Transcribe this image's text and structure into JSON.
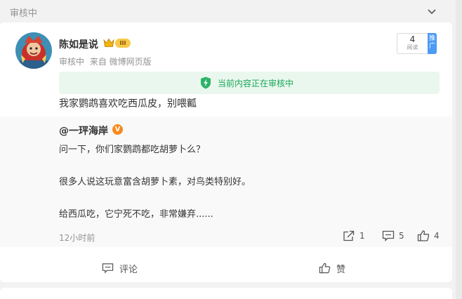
{
  "section": {
    "title": "审核中"
  },
  "post": {
    "username": "陈如是说",
    "vip_badge": "III",
    "meta": {
      "status": "审核中",
      "source": "来自 微博网页版"
    },
    "reads": {
      "count": "4",
      "label": "阅读"
    },
    "promote_label": "推广",
    "notice": "当前内容正在审核中",
    "text": "我家鹦鹉喜欢吃西瓜皮，别喂瓤"
  },
  "quote": {
    "username": "@一玶海岸",
    "verified_badge": "V",
    "lines": [
      "问一下，你们家鹦鹉都吃胡萝卜么？",
      "很多人说这玩意富含胡萝卜素，对鸟类特别好。",
      "给西瓜吃，它宁死不吃，非常嫌弃......"
    ],
    "time": "12小时前",
    "stats": {
      "reposts": "1",
      "comments": "5",
      "likes": "4"
    }
  },
  "actions": {
    "comment": "评论",
    "like": "赞"
  },
  "colors": {
    "accent_green": "#1aa75a",
    "notice_bg": "#eaf7ee",
    "promote_blue": "#4c9bf5",
    "verified_orange": "#f78a1d"
  }
}
